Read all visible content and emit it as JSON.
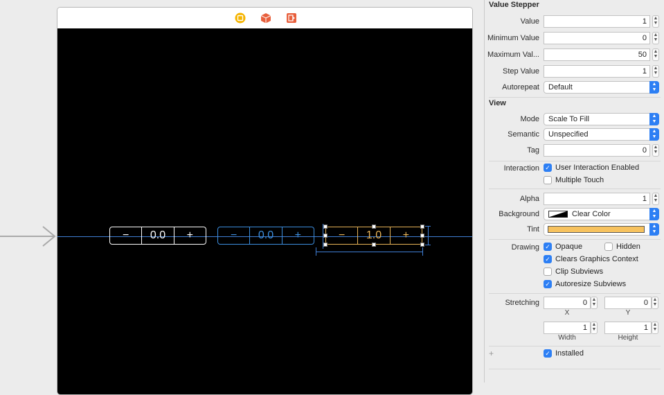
{
  "canvas": {
    "dock_icons": [
      "view-controller-icon",
      "first-responder-icon",
      "exit-icon"
    ],
    "steppers": [
      {
        "name": "stepper-white",
        "minus": "−",
        "value": "0.0",
        "plus": "+",
        "color": "#ffffff"
      },
      {
        "name": "stepper-blue",
        "minus": "−",
        "value": "0.0",
        "plus": "+",
        "color": "#3d8fe0"
      },
      {
        "name": "stepper-orange",
        "minus": "−",
        "value": "1.0",
        "plus": "+",
        "color": "#e8b458"
      }
    ]
  },
  "inspector": {
    "value_stepper": {
      "title": "Value Stepper",
      "value_label": "Value",
      "value": "1",
      "min_label": "Minimum Value",
      "min": "0",
      "max_label": "Maximum Val...",
      "max": "50",
      "step_label": "Step Value",
      "step": "1",
      "autorepeat_label": "Autorepeat",
      "autorepeat": "Default"
    },
    "view": {
      "title": "View",
      "mode_label": "Mode",
      "mode": "Scale To Fill",
      "semantic_label": "Semantic",
      "semantic": "Unspecified",
      "tag_label": "Tag",
      "tag": "0",
      "interaction_label": "Interaction",
      "user_interaction": "User Interaction Enabled",
      "multiple_touch": "Multiple Touch",
      "alpha_label": "Alpha",
      "alpha": "1",
      "background_label": "Background",
      "background": "Clear Color",
      "tint_label": "Tint",
      "tint_color": "#f7c25e",
      "drawing_label": "Drawing",
      "opaque": "Opaque",
      "hidden": "Hidden",
      "clears": "Clears Graphics Context",
      "clip": "Clip Subviews",
      "autoresize": "Autoresize Subviews",
      "stretching_label": "Stretching",
      "stretch_x": "0",
      "stretch_y": "0",
      "x_label": "X",
      "y_label": "Y",
      "stretch_w": "1",
      "stretch_h": "1",
      "width_label": "Width",
      "height_label": "Height",
      "installed": "Installed",
      "plus": "+"
    },
    "accent": "#2d7ff4"
  }
}
